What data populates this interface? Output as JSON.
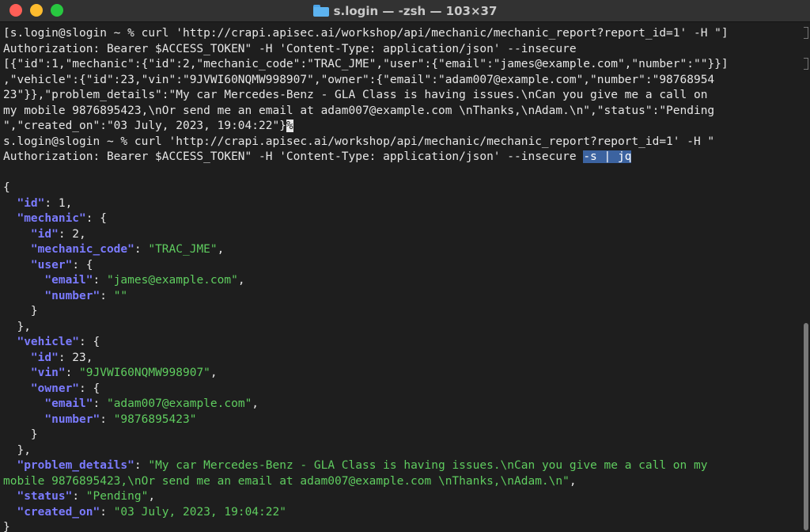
{
  "window": {
    "title": "s.login — -zsh — 103×37"
  },
  "terminal": {
    "lines": [
      [
        {
          "t": "[s.login@slogin ~ % curl 'http://crapi.apisec.ai/workshop/api/mechanic/mechanic_report?report_id=1' -H \"]"
        }
      ],
      [
        {
          "t": "Authorization: Bearer $ACCESS_TOKEN\" -H 'Content-Type: application/json' --insecure"
        }
      ],
      [
        {
          "t": "[{\"id\":1,\"mechanic\":{\"id\":2,\"mechanic_code\":\"TRAC_JME\",\"user\":{\"email\":\"james@example.com\",\"number\":\"\"}}]"
        }
      ],
      [
        {
          "t": ",\"vehicle\":{\"id\":23,\"vin\":\"9JVWI60NQMW998907\",\"owner\":{\"email\":\"adam007@example.com\",\"number\":\"98768954"
        }
      ],
      [
        {
          "t": "23\"}},\"problem_details\":\"My car Mercedes-Benz - GLA Class is having issues.\\nCan you give me a call on"
        }
      ],
      [
        {
          "t": "my mobile 9876895423,\\nOr send me an email at adam007@example.com \\nThanks,\\nAdam.\\n\",\"status\":\"Pending"
        }
      ],
      [
        {
          "t": "\",\"created_on\":\"03 July, 2023, 19:04:22\"}"
        },
        {
          "t": "%",
          "c": "cursor"
        }
      ],
      [
        {
          "t": "s.login@slogin ~ % curl 'http://crapi.apisec.ai/workshop/api/mechanic/mechanic_report?report_id=1' -H \""
        }
      ],
      [
        {
          "t": "Authorization: Bearer $ACCESS_TOKEN\" -H 'Content-Type: application/json' --insecure "
        },
        {
          "t": "-s | jq",
          "c": "sel"
        }
      ],
      [
        {
          "t": ""
        }
      ],
      [
        {
          "t": "{"
        }
      ],
      [
        {
          "t": "  "
        },
        {
          "t": "\"id\"",
          "c": "k"
        },
        {
          "t": ": 1,"
        }
      ],
      [
        {
          "t": "  "
        },
        {
          "t": "\"mechanic\"",
          "c": "k"
        },
        {
          "t": ": {"
        }
      ],
      [
        {
          "t": "    "
        },
        {
          "t": "\"id\"",
          "c": "k"
        },
        {
          "t": ": 2,"
        }
      ],
      [
        {
          "t": "    "
        },
        {
          "t": "\"mechanic_code\"",
          "c": "k"
        },
        {
          "t": ": "
        },
        {
          "t": "\"TRAC_JME\"",
          "c": "s"
        },
        {
          "t": ","
        }
      ],
      [
        {
          "t": "    "
        },
        {
          "t": "\"user\"",
          "c": "k"
        },
        {
          "t": ": {"
        }
      ],
      [
        {
          "t": "      "
        },
        {
          "t": "\"email\"",
          "c": "k"
        },
        {
          "t": ": "
        },
        {
          "t": "\"james@example.com\"",
          "c": "s"
        },
        {
          "t": ","
        }
      ],
      [
        {
          "t": "      "
        },
        {
          "t": "\"number\"",
          "c": "k"
        },
        {
          "t": ": "
        },
        {
          "t": "\"\"",
          "c": "s"
        }
      ],
      [
        {
          "t": "    }"
        }
      ],
      [
        {
          "t": "  },"
        }
      ],
      [
        {
          "t": "  "
        },
        {
          "t": "\"vehicle\"",
          "c": "k"
        },
        {
          "t": ": {"
        }
      ],
      [
        {
          "t": "    "
        },
        {
          "t": "\"id\"",
          "c": "k"
        },
        {
          "t": ": 23,"
        }
      ],
      [
        {
          "t": "    "
        },
        {
          "t": "\"vin\"",
          "c": "k"
        },
        {
          "t": ": "
        },
        {
          "t": "\"9JVWI60NQMW998907\"",
          "c": "s"
        },
        {
          "t": ","
        }
      ],
      [
        {
          "t": "    "
        },
        {
          "t": "\"owner\"",
          "c": "k"
        },
        {
          "t": ": {"
        }
      ],
      [
        {
          "t": "      "
        },
        {
          "t": "\"email\"",
          "c": "k"
        },
        {
          "t": ": "
        },
        {
          "t": "\"adam007@example.com\"",
          "c": "s"
        },
        {
          "t": ","
        }
      ],
      [
        {
          "t": "      "
        },
        {
          "t": "\"number\"",
          "c": "k"
        },
        {
          "t": ": "
        },
        {
          "t": "\"9876895423\"",
          "c": "s"
        }
      ],
      [
        {
          "t": "    }"
        }
      ],
      [
        {
          "t": "  },"
        }
      ],
      [
        {
          "t": "  "
        },
        {
          "t": "\"problem_details\"",
          "c": "k"
        },
        {
          "t": ": "
        },
        {
          "t": "\"My car Mercedes-Benz - GLA Class is having issues.\\nCan you give me a call on my",
          "c": "s"
        }
      ],
      [
        {
          "t": "mobile 9876895423,\\nOr send me an email at adam007@example.com \\nThanks,\\nAdam.\\n\"",
          "c": "s"
        },
        {
          "t": ","
        }
      ],
      [
        {
          "t": "  "
        },
        {
          "t": "\"status\"",
          "c": "k"
        },
        {
          "t": ": "
        },
        {
          "t": "\"Pending\"",
          "c": "s"
        },
        {
          "t": ","
        }
      ],
      [
        {
          "t": "  "
        },
        {
          "t": "\"created_on\"",
          "c": "k"
        },
        {
          "t": ": "
        },
        {
          "t": "\"03 July, 2023, 19:04:22\"",
          "c": "s"
        }
      ],
      [
        {
          "t": "}"
        }
      ]
    ]
  },
  "colors": {
    "key": "#7b7bff",
    "string": "#5fcc5f",
    "selection": "#3c63a0",
    "background": "#1e1e1e"
  }
}
